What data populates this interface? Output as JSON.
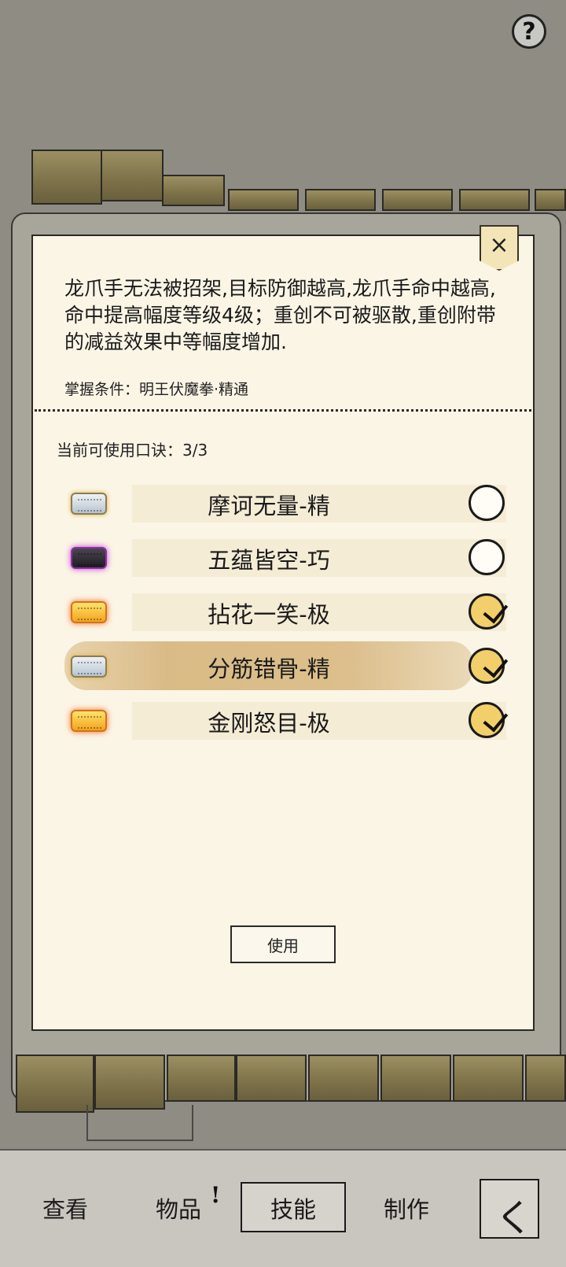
{
  "help": {
    "label": "?"
  },
  "dialog": {
    "close_label": "×",
    "description": "龙爪手无法被招架,目标防御越高,龙爪手命中越高,命中提高幅度等级4级；重创不可被驱散,重创附带的减益效果中等幅度增加.",
    "condition": "掌握条件：明王伏魔拳·精通",
    "available_label": "当前可使用口诀：3/3",
    "items": [
      {
        "name": "摩诃无量-精",
        "gem": "silver",
        "checked": false,
        "selected": false
      },
      {
        "name": "五蕴皆空-巧",
        "gem": "dark",
        "checked": false,
        "selected": false
      },
      {
        "name": "拈花一笑-极",
        "gem": "gold",
        "checked": true,
        "selected": false
      },
      {
        "name": "分筋错骨-精",
        "gem": "silver",
        "checked": true,
        "selected": true
      },
      {
        "name": "金刚怒目-极",
        "gem": "gold",
        "checked": true,
        "selected": false
      }
    ],
    "use_label": "使用"
  },
  "nav": {
    "view": "查看",
    "items": "物品",
    "items_badge": "!",
    "skills": "技能",
    "craft": "制作",
    "back_icon": "back-arrow-icon",
    "back_glyph": "く"
  },
  "colors": {
    "paper": "#fbf5e6",
    "highlight": "#d9bb86",
    "gem_silver": "#b8c3cf",
    "gem_dark": "#1f1c24",
    "gem_gold": "#f3a31b"
  }
}
